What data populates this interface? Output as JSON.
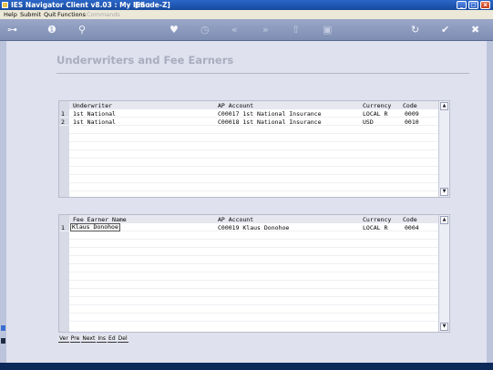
{
  "window": {
    "title": "IES Navigator Client v8.03 : My IES :",
    "mode": "[mode-Z]"
  },
  "menu": [
    "Help",
    "Submit",
    "Quit",
    "Functions",
    "Commands"
  ],
  "toolbar": {
    "icons": [
      "key-icon",
      "info-icon",
      "search-icon",
      "heart-icon",
      "clock-icon",
      "rewind-icon",
      "forward-icon",
      "upload-icon",
      "bookmark-icon",
      "refresh-icon",
      "check-icon",
      "close-icon"
    ]
  },
  "page": {
    "title": "Underwriters and Fee Earners"
  },
  "underwriters": {
    "headers": {
      "name": "Underwriter",
      "account": "AP Account",
      "currency": "Currency",
      "code": "Code"
    },
    "rows": [
      {
        "num": "1",
        "name": "1st National",
        "account": "C00017 1st National Insurance",
        "currency": "LOCAL R",
        "code": "0009"
      },
      {
        "num": "2",
        "name": "1st National",
        "account": "C00018 1st National Insurance",
        "currency": "USD",
        "code": "0010"
      }
    ]
  },
  "fee_earners": {
    "headers": {
      "name": "Fee Earner Name",
      "account": "AP Account",
      "currency": "Currency",
      "code": "Code"
    },
    "rows": [
      {
        "num": "1",
        "name": "Klaus Donohoe",
        "account": "C00019 Klaus Donohoe",
        "currency": "LOCAL R",
        "code": "0004"
      }
    ]
  },
  "buttons": [
    "Ver",
    "Pre",
    "Next",
    "Ins",
    "Ed",
    "Del"
  ]
}
